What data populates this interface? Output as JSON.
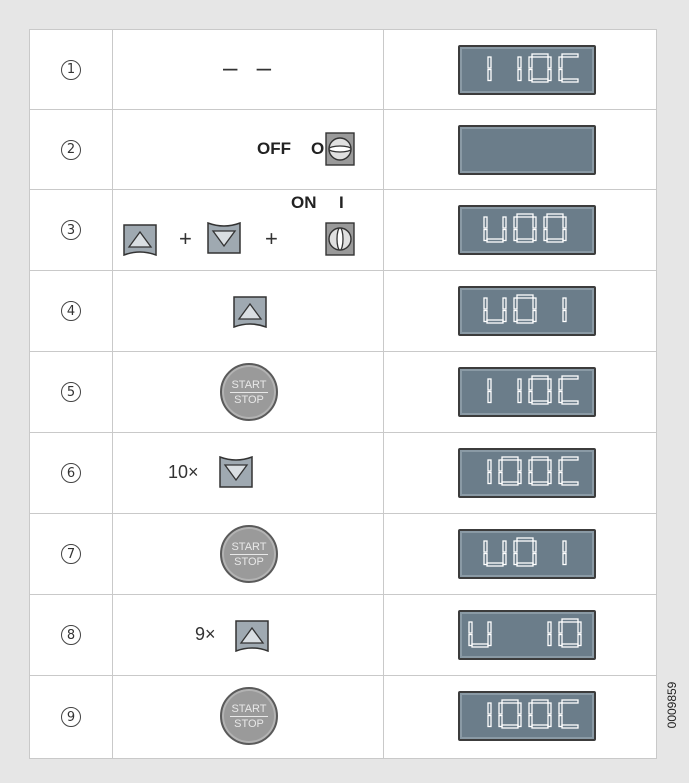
{
  "figure_ref": "0009859",
  "colors": {
    "lcd_bg": "#6b7d8a",
    "lcd_seg": "#ffffff",
    "key_fill": "#9fa9b1",
    "button_fill": "#9a9a9a"
  },
  "steps": [
    {
      "num": "1",
      "action": {
        "kind": "dashes",
        "text": "– –"
      },
      "display": "110C"
    },
    {
      "num": "2",
      "action": {
        "kind": "switch-off",
        "label": "OFF",
        "symbol": "O"
      },
      "display": ""
    },
    {
      "num": "3",
      "action": {
        "kind": "combo-on",
        "label": "ON",
        "symbol": "I",
        "plus": "+"
      },
      "display": "U00"
    },
    {
      "num": "4",
      "action": {
        "kind": "up-key"
      },
      "display": "U01"
    },
    {
      "num": "5",
      "action": {
        "kind": "start-stop",
        "label_top": "START",
        "label_bottom": "STOP"
      },
      "display": "110C"
    },
    {
      "num": "6",
      "action": {
        "kind": "down-times",
        "times": "10×"
      },
      "display": "100C"
    },
    {
      "num": "7",
      "action": {
        "kind": "start-stop",
        "label_top": "START",
        "label_bottom": "STOP"
      },
      "display": "U01"
    },
    {
      "num": "8",
      "action": {
        "kind": "up-times",
        "times": "9×"
      },
      "display": "U 10"
    },
    {
      "num": "9",
      "action": {
        "kind": "start-stop",
        "label_top": "START",
        "label_bottom": "STOP"
      },
      "display": "100C"
    }
  ]
}
